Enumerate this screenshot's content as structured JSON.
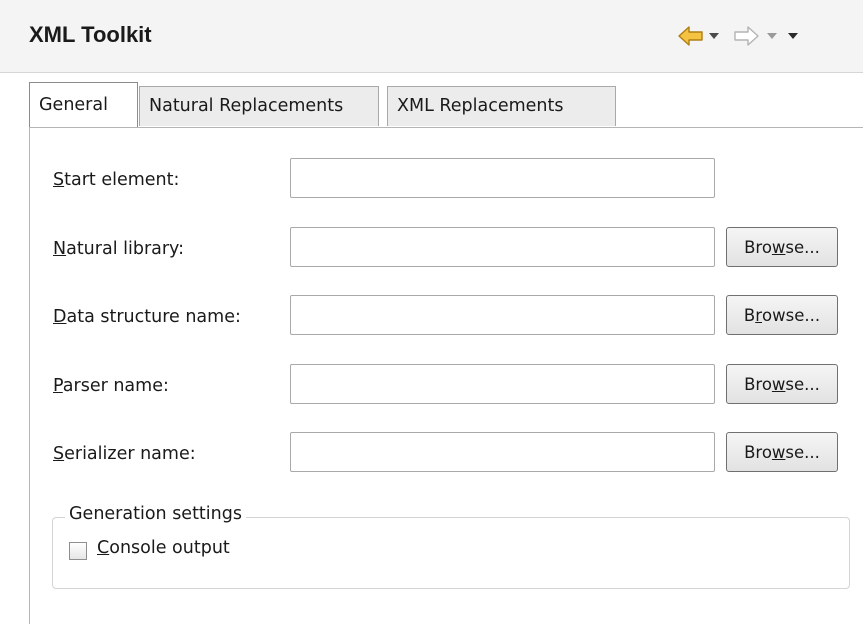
{
  "view": {
    "title": "XML Toolkit",
    "icons": {
      "back": "back-arrow-icon",
      "back_menu": "chevron-down-icon",
      "forward": "forward-arrow-icon",
      "forward_menu": "chevron-down-icon",
      "view_menu": "view-menu-icon"
    },
    "colors": {
      "back_arrow": "#f5c242",
      "selected_tab_bg": "#ffffff",
      "unselected_tab_bg": "#ececec"
    }
  },
  "tabs": [
    {
      "label": "General",
      "selected": true
    },
    {
      "label": "Natural Replacements",
      "selected": false
    },
    {
      "label": "XML Replacements",
      "selected": false
    }
  ],
  "form": {
    "start_element": {
      "label_mn": "S",
      "label_rest": "tart element:",
      "value": ""
    },
    "natural_library": {
      "label_mn": "N",
      "label_rest": "atural library:",
      "value": "",
      "browse_pre": "Bro",
      "browse_mn": "w",
      "browse_post": "se..."
    },
    "data_structure": {
      "label_mn": "D",
      "label_rest": "ata structure name:",
      "value": "",
      "browse_pre": "B",
      "browse_mn": "r",
      "browse_post": "owse..."
    },
    "parser": {
      "label_mn": "P",
      "label_rest": "arser name:",
      "value": "",
      "browse_pre": "Bro",
      "browse_mn": "w",
      "browse_post": "se..."
    },
    "serializer": {
      "label_mn": "S",
      "label_rest": "erializer name:",
      "value": "",
      "browse_pre": "Bro",
      "browse_mn": "w",
      "browse_post": "se..."
    }
  },
  "generation": {
    "title": "Generation settings",
    "console_output": {
      "label_mn": "C",
      "label_rest": "onsole output",
      "checked": false
    }
  }
}
